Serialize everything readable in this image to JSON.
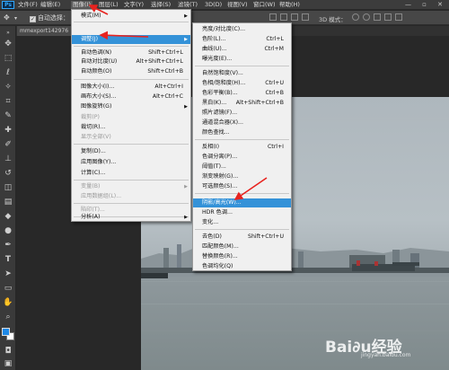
{
  "app": {
    "logo": "Ps",
    "menus": [
      {
        "id": "file",
        "label": "文件(F)"
      },
      {
        "id": "edit",
        "label": "编辑(E)"
      },
      {
        "id": "image",
        "label": "图像(I)"
      },
      {
        "id": "layer",
        "label": "图层(L)"
      },
      {
        "id": "type",
        "label": "文字(Y)"
      },
      {
        "id": "select",
        "label": "选择(S)"
      },
      {
        "id": "filter",
        "label": "滤镜(T)"
      },
      {
        "id": "3d",
        "label": "3D(D)"
      },
      {
        "id": "view",
        "label": "视图(V)"
      },
      {
        "id": "window",
        "label": "窗口(W)"
      },
      {
        "id": "help",
        "label": "帮助(H)"
      }
    ],
    "window_buttons": "— ▫ ✕"
  },
  "options_bar": {
    "auto_select_label": "自动选择：",
    "auto_select_checked": "✓",
    "mode_3d_label": "3D 模式："
  },
  "document_tab": {
    "title": "mmexport142976"
  },
  "image_menu": {
    "items": [
      {
        "label": "模式(M)",
        "shortcut": "",
        "submenu": true,
        "disabled": false
      },
      {
        "label": "调整(J)",
        "shortcut": "",
        "submenu": true,
        "disabled": false,
        "active": true
      },
      {
        "label": "自动色调(N)",
        "shortcut": "Shift+Ctrl+L",
        "disabled": false
      },
      {
        "label": "自动对比度(U)",
        "shortcut": "Alt+Shift+Ctrl+L",
        "disabled": false
      },
      {
        "label": "自动颜色(O)",
        "shortcut": "Shift+Ctrl+B",
        "disabled": false
      },
      {
        "label": "图像大小(I)...",
        "shortcut": "Alt+Ctrl+I",
        "disabled": false
      },
      {
        "label": "画布大小(S)...",
        "shortcut": "Alt+Ctrl+C",
        "disabled": false
      },
      {
        "label": "图像旋转(G)",
        "shortcut": "",
        "submenu": true,
        "disabled": false
      },
      {
        "label": "裁剪(P)",
        "shortcut": "",
        "disabled": true
      },
      {
        "label": "裁切(R)...",
        "shortcut": "",
        "disabled": false
      },
      {
        "label": "显示全部(V)",
        "shortcut": "",
        "disabled": true
      },
      {
        "label": "复制(D)...",
        "shortcut": "",
        "disabled": false
      },
      {
        "label": "应用图像(Y)...",
        "shortcut": "",
        "disabled": false
      },
      {
        "label": "计算(C)...",
        "shortcut": "",
        "disabled": false
      },
      {
        "label": "变量(B)",
        "shortcut": "",
        "submenu": true,
        "disabled": true
      },
      {
        "label": "应用数据组(L)...",
        "shortcut": "",
        "disabled": true
      },
      {
        "label": "陷印(T)...",
        "shortcut": "",
        "disabled": true
      },
      {
        "label": "分析(A)",
        "shortcut": "",
        "submenu": true,
        "disabled": false
      }
    ]
  },
  "adjust_menu": {
    "items": [
      {
        "label": "亮度/对比度(C)...",
        "shortcut": ""
      },
      {
        "label": "色阶(L)...",
        "shortcut": "Ctrl+L"
      },
      {
        "label": "曲线(U)...",
        "shortcut": "Ctrl+M"
      },
      {
        "label": "曝光度(E)...",
        "shortcut": ""
      },
      {
        "label": "自然饱和度(V)...",
        "shortcut": ""
      },
      {
        "label": "色相/饱和度(H)...",
        "shortcut": "Ctrl+U"
      },
      {
        "label": "色彩平衡(B)...",
        "shortcut": "Ctrl+B"
      },
      {
        "label": "黑白(K)...",
        "shortcut": "Alt+Shift+Ctrl+B"
      },
      {
        "label": "照片滤镜(F)...",
        "shortcut": ""
      },
      {
        "label": "通道混合器(X)...",
        "shortcut": ""
      },
      {
        "label": "颜色查找...",
        "shortcut": ""
      },
      {
        "label": "反相(I)",
        "shortcut": "Ctrl+I"
      },
      {
        "label": "色调分离(P)...",
        "shortcut": ""
      },
      {
        "label": "阈值(T)...",
        "shortcut": ""
      },
      {
        "label": "渐变映射(G)...",
        "shortcut": ""
      },
      {
        "label": "可选颜色(S)...",
        "shortcut": ""
      },
      {
        "label": "阴影/高光(W)...",
        "shortcut": "",
        "active": true
      },
      {
        "label": "HDR 色调...",
        "shortcut": ""
      },
      {
        "label": "变化...",
        "shortcut": ""
      },
      {
        "label": "去色(D)",
        "shortcut": "Shift+Ctrl+U"
      },
      {
        "label": "匹配颜色(M)...",
        "shortcut": ""
      },
      {
        "label": "替换颜色(R)...",
        "shortcut": ""
      },
      {
        "label": "色调均化(Q)",
        "shortcut": ""
      }
    ]
  },
  "watermark": {
    "text": "Bai∂u经验",
    "sub": "jingyan.baidu.com"
  },
  "colors": {
    "accent": "#3492d8",
    "annotation": "#e8231f",
    "foreground": "#1e88e5",
    "background": "#ffffff"
  }
}
